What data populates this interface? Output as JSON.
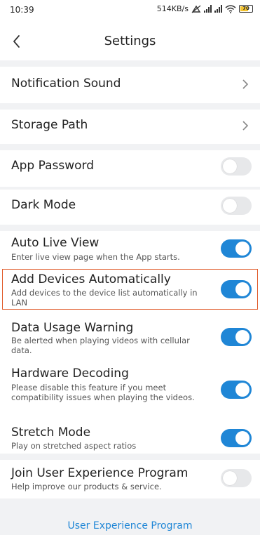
{
  "status_bar": {
    "time": "10:39",
    "speed": "514KB/s",
    "battery": "70"
  },
  "header": {
    "title": "Settings"
  },
  "settings": {
    "notification_sound": {
      "label": "Notification Sound"
    },
    "storage_path": {
      "label": "Storage Path"
    },
    "app_password": {
      "label": "App Password",
      "enabled": false
    },
    "dark_mode": {
      "label": "Dark Mode",
      "enabled": false
    },
    "auto_live_view": {
      "label": "Auto Live View",
      "description": "Enter live view page when the App starts.",
      "enabled": true
    },
    "add_devices_automatically": {
      "label": "Add Devices Automatically",
      "description": "Add devices to the device list automatically in LAN",
      "enabled": true,
      "highlighted": true
    },
    "data_usage_warning": {
      "label": "Data Usage Warning",
      "description": "Be alerted when playing videos with cellular data.",
      "enabled": true
    },
    "hardware_decoding": {
      "label": "Hardware Decoding",
      "description": "Please disable this feature if you meet compatibility issues when playing the videos.",
      "enabled": true
    },
    "stretch_mode": {
      "label": "Stretch Mode",
      "description": "Play on stretched aspect ratios",
      "enabled": true
    },
    "join_user_experience": {
      "label": "Join User Experience Program",
      "description": "Help improve our products & service.",
      "enabled": false
    }
  },
  "footer": {
    "link": "User Experience Program"
  },
  "colors": {
    "accent": "#1f86d6",
    "highlight_border": "#e05a2a",
    "section_gap": "#f1f2f4"
  }
}
